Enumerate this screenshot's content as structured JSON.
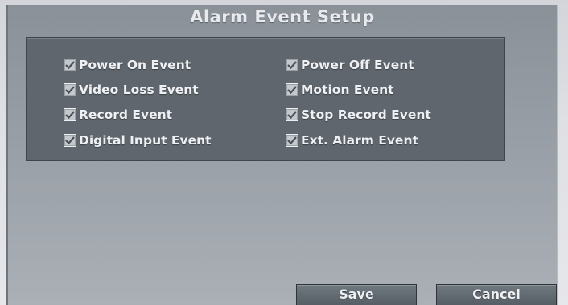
{
  "dialog": {
    "title": "Alarm Event Setup"
  },
  "events": {
    "items": [
      {
        "label": "Power On Event",
        "checked": true
      },
      {
        "label": "Power Off Event",
        "checked": true
      },
      {
        "label": "Video Loss Event",
        "checked": true
      },
      {
        "label": "Motion Event",
        "checked": true
      },
      {
        "label": "Record Event",
        "checked": true
      },
      {
        "label": "Stop Record Event",
        "checked": true
      },
      {
        "label": "Digital Input Event",
        "checked": true
      },
      {
        "label": "Ext. Alarm Event",
        "checked": true
      }
    ]
  },
  "buttons": {
    "save_label": "Save",
    "cancel_label": "Cancel"
  },
  "icons": {
    "checkbox": "checkmark-icon"
  },
  "colors": {
    "panel": "#5f666d",
    "dialog": "#9aa0a7",
    "text": "#eef0f3",
    "button": "#5f666d"
  }
}
